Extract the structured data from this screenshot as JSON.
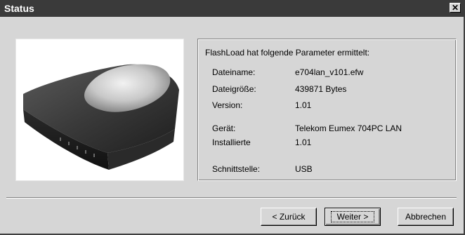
{
  "window": {
    "title": "Status",
    "close_glyph": "✕"
  },
  "image": {
    "description_icon": "router-device-icon"
  },
  "info": {
    "intro": "FlashLoad hat folgende Parameter ermittelt:",
    "rows": [
      {
        "label": "Dateiname:",
        "value": "e704lan_v101.efw"
      },
      {
        "label": "Dateigröße:",
        "value": "439871 Bytes"
      },
      {
        "label": "Version:",
        "value": "1.01"
      },
      {
        "label": "Gerät:",
        "value": "Telekom Eumex 704PC LAN"
      },
      {
        "label": "Installierte",
        "value": "1.01"
      },
      {
        "label": "Schnittstelle:",
        "value": "USB"
      }
    ]
  },
  "buttons": {
    "back": "< Zurück",
    "next": "Weiter >",
    "cancel": "Abbrechen"
  }
}
